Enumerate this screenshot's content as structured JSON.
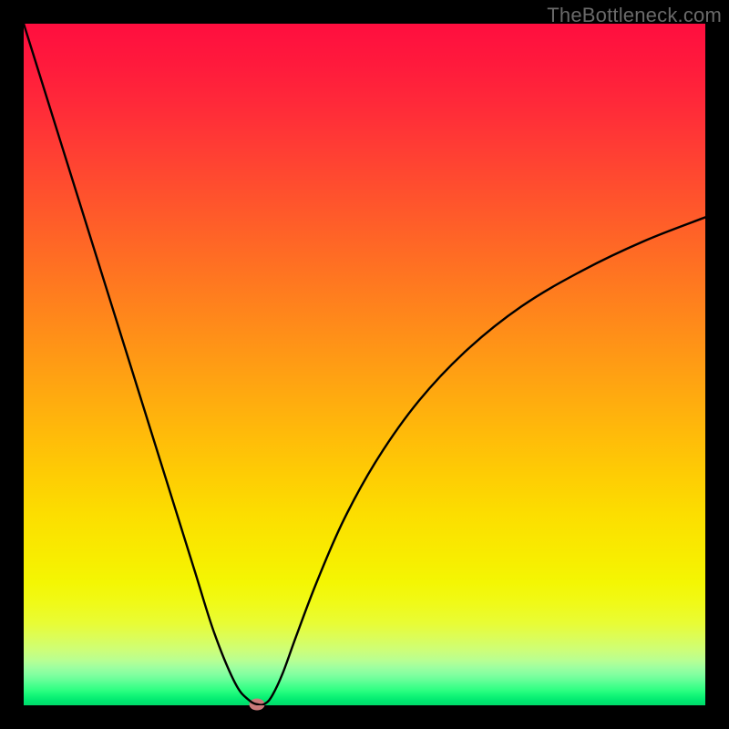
{
  "watermark": "TheBottleneck.com",
  "chart_data": {
    "type": "line",
    "title": "",
    "xlabel": "",
    "ylabel": "",
    "xlim": [
      0,
      100
    ],
    "ylim": [
      0,
      100
    ],
    "grid": false,
    "legend": false,
    "series": [
      {
        "name": "bottleneck-curve",
        "x": [
          0,
          5,
          10,
          15,
          20,
          25,
          28,
          31,
          33,
          34.5,
          35.5,
          36.5,
          38,
          40,
          43,
          47,
          52,
          58,
          65,
          73,
          82,
          91,
          100
        ],
        "y": [
          100,
          84,
          68,
          52,
          36,
          20,
          10.5,
          3.3,
          0.8,
          0.1,
          0.3,
          1.5,
          4.7,
          10.2,
          18.1,
          27.3,
          36.3,
          44.7,
          52.1,
          58.5,
          63.8,
          68.1,
          71.6
        ]
      }
    ],
    "annotations": [
      {
        "name": "min-marker",
        "x": 34.2,
        "y": 0.2,
        "color": "#c97a7a"
      }
    ],
    "background_gradient": {
      "top": "#ff0e3f",
      "mid": "#fecc04",
      "bottom": "#00da6a"
    }
  }
}
